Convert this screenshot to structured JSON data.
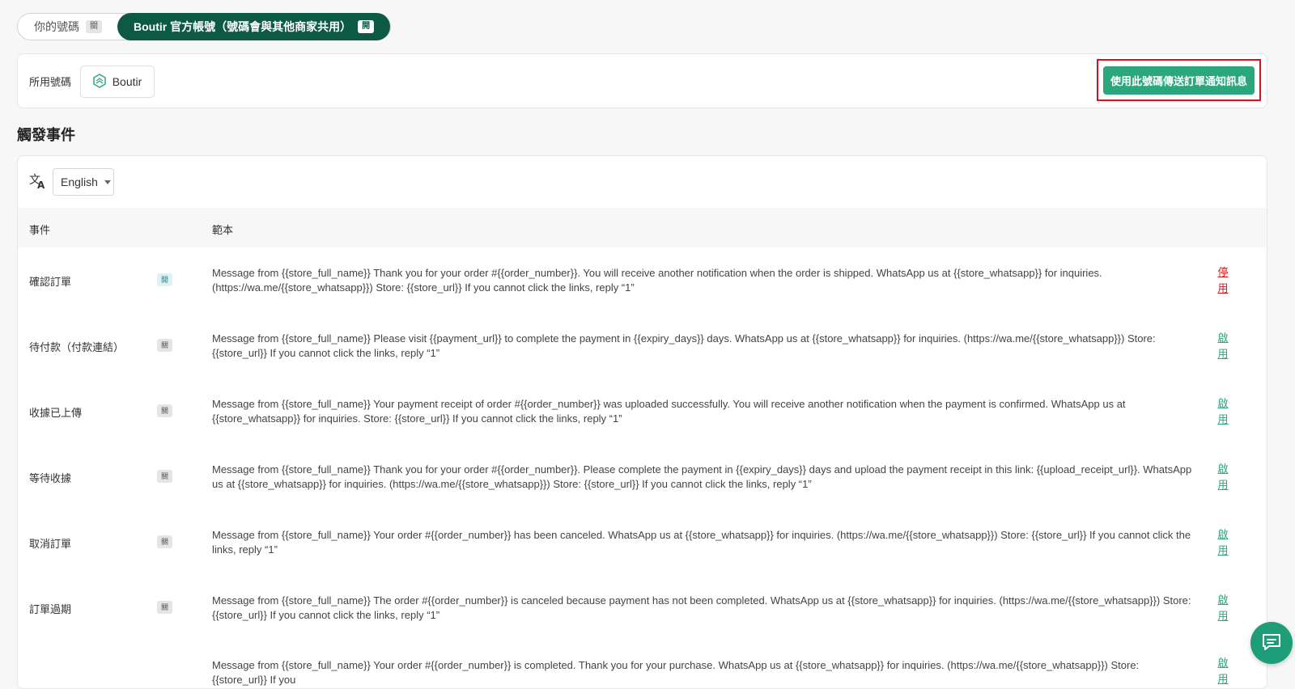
{
  "tabs": [
    {
      "label": "你的號碼",
      "tag": "關"
    },
    {
      "label": "Boutir 官方帳號（號碼會與其他商家共用）",
      "tag": "開"
    }
  ],
  "number_section": {
    "label": "所用號碼",
    "brand": "Boutir",
    "use_button": "使用此號碼傳送訂單通知訊息"
  },
  "trigger_title": "觸發事件",
  "language": {
    "selected": "English"
  },
  "table": {
    "headers": {
      "event": "事件",
      "template": "範本"
    },
    "rows": [
      {
        "event": "確認訂單",
        "status": "開",
        "action": "停用",
        "template": "Message from {{store_full_name}} Thank you for your order #{{order_number}}. You will receive another notification when the order is shipped. WhatsApp us at {{store_whatsapp}} for inquiries. (https://wa.me/{{store_whatsapp}}) Store: {{store_url}} If you cannot click the links, reply “1”"
      },
      {
        "event": "待付款（付款連結）",
        "status": "關",
        "action": "啟用",
        "template": "Message from {{store_full_name}} Please visit {{payment_url}} to complete the payment in {{expiry_days}} days. WhatsApp us at {{store_whatsapp}} for inquiries. (https://wa.me/{{store_whatsapp}}) Store: {{store_url}} If you cannot click the links, reply “1”"
      },
      {
        "event": "收據已上傳",
        "status": "關",
        "action": "啟用",
        "template": "Message from {{store_full_name}} Your payment receipt of order #{{order_number}} was uploaded successfully. You will receive another notification when the payment is confirmed. WhatsApp us at {{store_whatsapp}} for inquiries. Store: {{store_url}} If you cannot click the links, reply “1”"
      },
      {
        "event": "等待收據",
        "status": "關",
        "action": "啟用",
        "template": "Message from {{store_full_name}} Thank you for your order #{{order_number}}. Please complete the payment in {{expiry_days}} days and upload the payment receipt in this link: {{upload_receipt_url}}. WhatsApp us at {{store_whatsapp}} for inquiries. (https://wa.me/{{store_whatsapp}}) Store: {{store_url}} If you cannot click the links, reply “1”"
      },
      {
        "event": "取消訂單",
        "status": "關",
        "action": "啟用",
        "template": "Message from {{store_full_name}} Your order #{{order_number}} has been canceled. WhatsApp us at {{store_whatsapp}} for inquiries. (https://wa.me/{{store_whatsapp}}) Store: {{store_url}} If you cannot click the links, reply “1”"
      },
      {
        "event": "訂單過期",
        "status": "關",
        "action": "啟用",
        "template": "Message from {{store_full_name}} The order #{{order_number}} is canceled because payment has not been completed. WhatsApp us at {{store_whatsapp}} for inquiries. (https://wa.me/{{store_whatsapp}}) Store: {{store_url}} If you cannot click the links, reply “1”"
      },
      {
        "event": "",
        "status": "",
        "action": "啟用",
        "template": "Message from {{store_full_name}} Your order #{{order_number}} is completed. Thank you for your purchase. WhatsApp us at {{store_whatsapp}} for inquiries. (https://wa.me/{{store_whatsapp}}) Store: {{store_url}} If you"
      }
    ]
  },
  "colors": {
    "brand_dark": "#0c5a44",
    "primary": "#2ca67b",
    "danger": "#d8141a"
  },
  "icons": {
    "translate": "translate-icon",
    "brand": "boutir-logo",
    "chat": "chat-icon"
  }
}
